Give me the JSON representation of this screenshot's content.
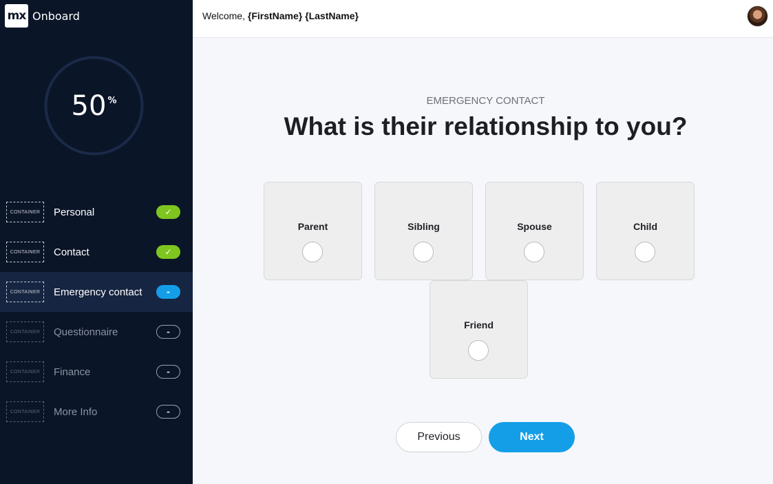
{
  "brand": {
    "logo_text": "mx",
    "name": "Onboard"
  },
  "progress": {
    "value": "50",
    "unit": "%",
    "fraction": 0.5
  },
  "steps": [
    {
      "label": "Personal",
      "container": "CONTAINER",
      "status": "done",
      "pill": "✓"
    },
    {
      "label": "Contact",
      "container": "CONTAINER",
      "status": "done",
      "pill": "✓"
    },
    {
      "label": "Emergency contact",
      "container": "CONTAINER",
      "status": "current",
      "pill": "-"
    },
    {
      "label": "Questionnaire",
      "container": "CONTAINER",
      "status": "pending",
      "pill": "-"
    },
    {
      "label": "Finance",
      "container": "CONTAINER",
      "status": "pending",
      "pill": "-"
    },
    {
      "label": "More Info",
      "container": "CONTAINER",
      "status": "pending",
      "pill": "-"
    }
  ],
  "header": {
    "welcome_prefix": "Welcome,",
    "user_name": "{FirstName} {LastName}"
  },
  "main": {
    "eyebrow": "EMERGENCY CONTACT",
    "question": "What is their relationship to you?",
    "options": [
      {
        "label": "Parent"
      },
      {
        "label": "Sibling"
      },
      {
        "label": "Spouse"
      },
      {
        "label": "Child"
      },
      {
        "label": "Friend"
      }
    ]
  },
  "buttons": {
    "previous": "Previous",
    "next": "Next"
  },
  "colors": {
    "sidebar": "#0b1528",
    "accent": "#149ee8",
    "done": "#7ec51f"
  }
}
